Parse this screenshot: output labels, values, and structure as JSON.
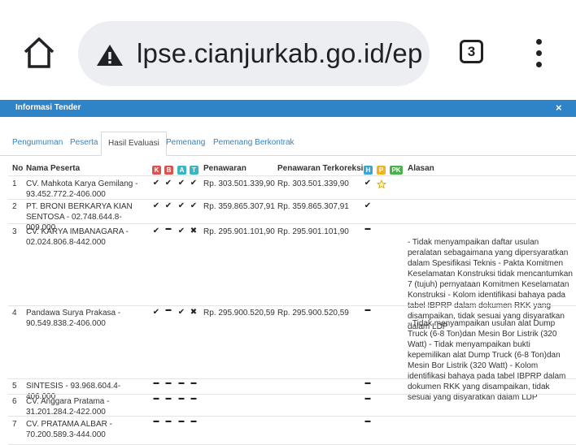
{
  "browser": {
    "url": "lpse.cianjurkab.go.id/ep",
    "tab_count": "3"
  },
  "modal": {
    "title": "Informasi Tender",
    "close": "×"
  },
  "tabs": [
    "Pengumuman",
    "Peserta",
    "Hasil Evaluasi",
    "Pemenang",
    "Pemenang Berkontrak"
  ],
  "active_tab": "Hasil Evaluasi",
  "table": {
    "headers": {
      "no": "No",
      "name": "Nama Peserta",
      "penawaran": "Penawaran",
      "terkoreksi": "Penawaran Terkoreksi",
      "alasan": "Alasan"
    },
    "eval_badges": [
      {
        "label": "K",
        "color": "#d9534f"
      },
      {
        "label": "B",
        "color": "#d9534f"
      },
      {
        "label": "A",
        "color": "#36b6c6"
      },
      {
        "label": "T",
        "color": "#36b6c6"
      }
    ],
    "result_badges": [
      {
        "label": "H",
        "color": "#36a6d8"
      },
      {
        "label": "P",
        "color": "#f0b323"
      },
      {
        "label": "PK",
        "color": "#4cae4c"
      }
    ],
    "rows": [
      {
        "no": "1",
        "name": "CV. Mahkota Karya Gemilang - 93.452.772.2-406.000",
        "marks": [
          "check",
          "check",
          "check",
          "check"
        ],
        "penawaran": "Rp. 303.501.339,90",
        "terkoreksi": "Rp. 303.501.339,90",
        "h": "check",
        "p": "star",
        "alasan": ""
      },
      {
        "no": "2",
        "name": "PT. BRONI BERKARYA KIAN SENTOSA - 02.748.644.8-009.000",
        "marks": [
          "check",
          "check",
          "check",
          "check"
        ],
        "penawaran": "Rp. 359.865.307,91",
        "terkoreksi": "Rp. 359.865.307,91",
        "h": "check",
        "p": "",
        "alasan": ""
      },
      {
        "no": "3",
        "name": "CV. KARYA IMBANAGARA - 02.024.806.8-442.000",
        "marks": [
          "check",
          "dash",
          "check",
          "cross"
        ],
        "penawaran": "Rp. 295.901.101,90",
        "terkoreksi": "Rp. 295.901.101,90",
        "h": "dash",
        "p": "",
        "alasan": "- Tidak menyampaikan daftar usulan peralatan sebagaimana yang dipersyaratkan dalam Spesifikasi Teknis - Pakta Komitmen Keselamatan Konstruksi tidak mencantumkan 7 (tujuh) pernyataan Komitmen Keselamatan Konstruksi - Kolom identifikasi bahaya pada tabel IBPRP dalam dokumen RKK yang disampaikan, tidak sesuai yang disyaratkan dalam LDP"
      },
      {
        "no": "4",
        "name": "Pandawa Surya Prakasa - 90.549.838.2-406.000",
        "marks": [
          "check",
          "dash",
          "check",
          "cross"
        ],
        "penawaran": "Rp. 295.900.520,59",
        "terkoreksi": "Rp. 295.900.520,59",
        "h": "dash",
        "p": "",
        "alasan": "- Tidak menyampaikan usulan alat Dump Truck (6-8 Ton)dan Mesin Bor Listrik (320 Watt) - Tidak menyampaikan bukti kepemilikan alat Dump Truck (6-8 Ton)dan Mesin Bor Listrik (320 Watt) - Kolom identifikasi bahaya pada tabel IBPRP dalam dokumen RKK yang disampaikan, tidak sesuai yang disyaratkan dalam LDP"
      },
      {
        "no": "5",
        "name": "SINTESIS - 93.968.604.4-406.000",
        "marks": [
          "dash",
          "dash",
          "dash",
          "dash"
        ],
        "penawaran": "",
        "terkoreksi": "",
        "h": "dash",
        "p": "",
        "alasan": ""
      },
      {
        "no": "6",
        "name": "CV. Anggara Pratama - 31.201.284.2-422.000",
        "marks": [
          "dash",
          "dash",
          "dash",
          "dash"
        ],
        "penawaran": "",
        "terkoreksi": "",
        "h": "dash",
        "p": "",
        "alasan": ""
      },
      {
        "no": "7",
        "name": "CV. PRATAMA ALBAR - 70.200.589.3-444.000",
        "marks": [
          "dash",
          "dash",
          "dash",
          "dash"
        ],
        "penawaran": "",
        "terkoreksi": "",
        "h": "dash",
        "p": "",
        "alasan": ""
      }
    ]
  },
  "icons": {
    "home": "home-icon",
    "warning": "warning-icon",
    "menu": "more-vert-icon",
    "check": "check-icon",
    "dash": "dash-icon",
    "cross": "cross-icon",
    "star": "star-icon"
  }
}
